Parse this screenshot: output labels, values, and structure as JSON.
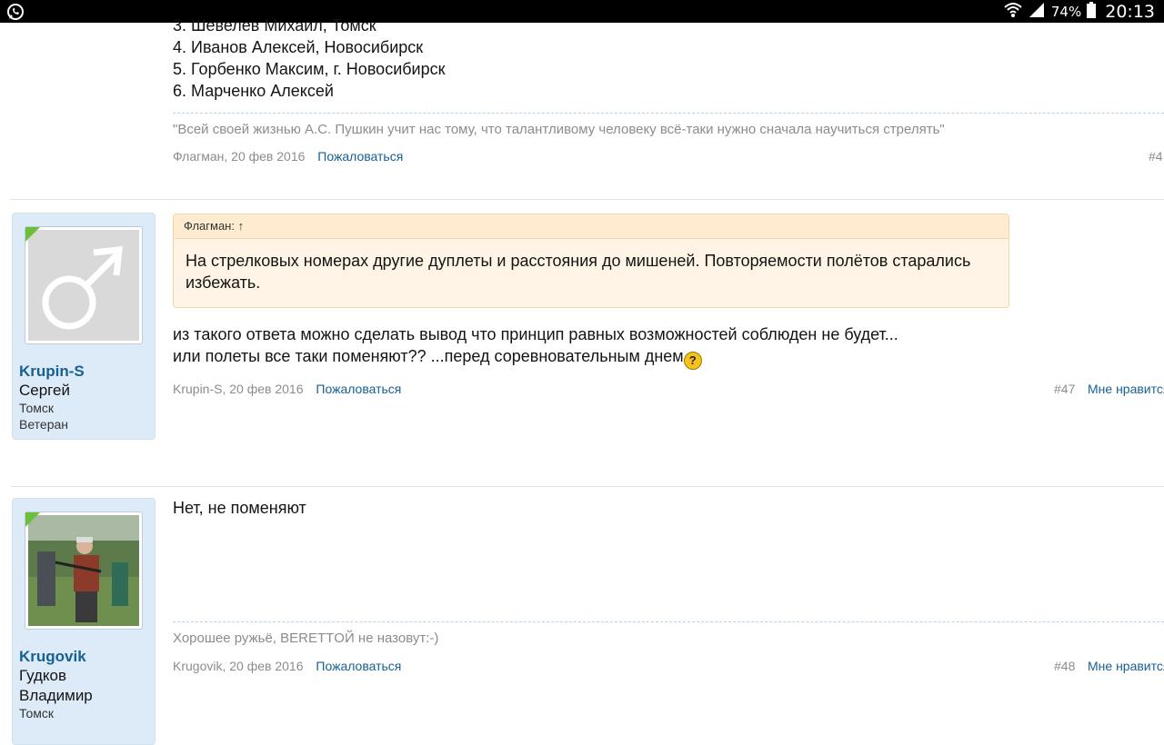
{
  "statusbar": {
    "app_icon": "whatsapp-icon",
    "battery_pct": "74%",
    "time": "20:13"
  },
  "post46": {
    "list": [
      "3. Шевелев Михаил, Томск",
      "4. Иванов Алексей, Новосибирск",
      "5. Горбенко Максим, г. Новосибирск",
      "6. Марченко Алексей"
    ],
    "signature": "\"Всей своей жизнью А.С. Пушкин учит нас тому, что талантливому человеку всё-таки нужно сначала научиться стрелять\"",
    "meta": "Флагман, 20 фев 2016",
    "report": "Пожаловаться",
    "num": "#4"
  },
  "post47": {
    "user": {
      "name": "Krupin-S",
      "real_name": "Сергей",
      "city": "Томск",
      "rank": "Ветеран"
    },
    "quote_author": "Флагман: ↑",
    "quote_text": "На стрелковых номерах другие дуплеты и расстояния до мишеней. Повторяемости полётов старались избежать.",
    "line1": "из такого ответа можно сделать вывод что принцип равных возможностей соблюден не будет...",
    "line2": "или полеты все таки поменяют?? ...перед соревновательным днем",
    "smiley": "?",
    "meta": "Krupin-S, 20 фев 2016",
    "report": "Пожаловаться",
    "num": "#47",
    "like": "Мне нравится"
  },
  "post48": {
    "user": {
      "name": "Krugovik",
      "real_name_1": "Гудков",
      "real_name_2": "Владимир",
      "city": "Томск"
    },
    "text": "Нет, не поменяют",
    "signature": "Хорошее ружьё, BERETTОЙ не назовут:-)",
    "meta": "Krugovik, 20 фев 2016",
    "report": "Пожаловаться",
    "num": "#48",
    "like": "Мне нравится"
  }
}
